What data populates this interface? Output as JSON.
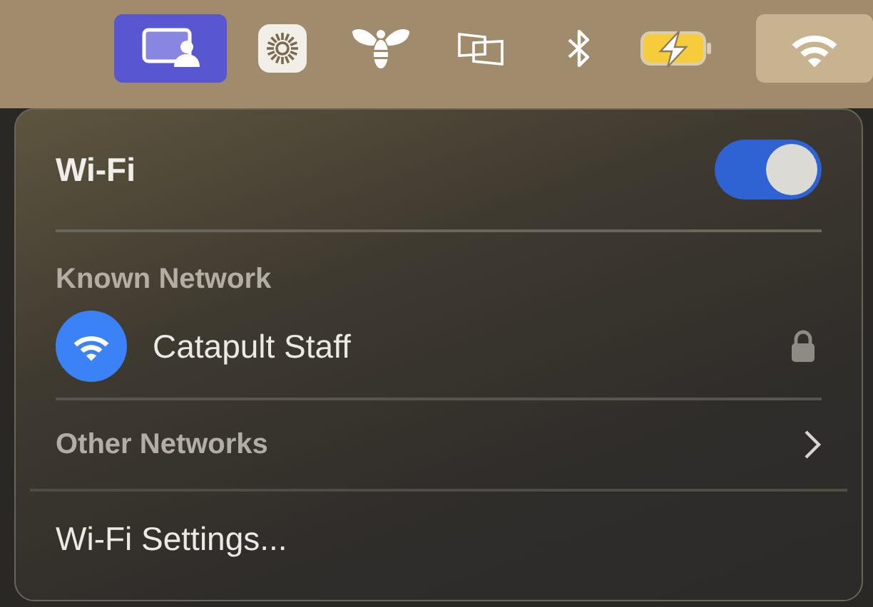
{
  "menu_bar": {
    "items": [
      {
        "kind": "screen-share",
        "selected": false
      },
      {
        "kind": "sunburst",
        "selected": false
      },
      {
        "kind": "bee",
        "selected": false
      },
      {
        "kind": "displays",
        "selected": false
      },
      {
        "kind": "bluetooth",
        "selected": false
      },
      {
        "kind": "battery",
        "selected": false
      },
      {
        "kind": "wifi",
        "selected": true
      }
    ]
  },
  "wifi_menu": {
    "title": "Wi-Fi",
    "toggle": {
      "on": true
    },
    "known_network": {
      "heading": "Known Network",
      "networks": [
        {
          "name": "Catapult Staff",
          "locked": true
        }
      ]
    },
    "other_networks": {
      "label": "Other Networks"
    },
    "settings": {
      "label": "Wi-Fi Settings..."
    }
  }
}
